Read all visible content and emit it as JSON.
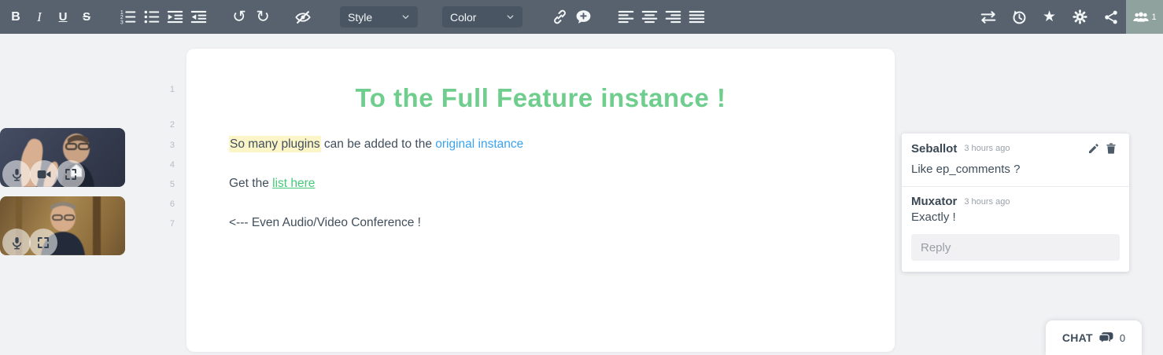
{
  "toolbar": {
    "format": {
      "bold": "B",
      "italic": "I",
      "underline": "U",
      "strikethrough": "S"
    },
    "undo_glyph": "↺",
    "redo_glyph": "↻",
    "star_glyph": "★",
    "style_dropdown_label": "Style",
    "color_dropdown_label": "Color",
    "users_count": "1"
  },
  "pad": {
    "line_numbers": [
      "1",
      "2",
      "3",
      "4",
      "5",
      "6",
      "7"
    ],
    "heading": "To the Full Feature instance !",
    "paragraph1": {
      "highlighted": "So many plugins",
      "middle": " can be added to the ",
      "link": "original instance"
    },
    "paragraph2": {
      "prefix": "Get the ",
      "link": "list here"
    },
    "paragraph3": "<--- Even Audio/Video Conference !"
  },
  "comments": {
    "items": [
      {
        "author": "Seballot",
        "time": "3 hours ago",
        "text": "Like ep_comments ?"
      },
      {
        "author": "Muxator",
        "time": "3 hours ago",
        "text": "Exactly !"
      }
    ],
    "reply_placeholder": "Reply"
  },
  "chat": {
    "label": "CHAT",
    "count": "0"
  },
  "video": {
    "participant1_controls": [
      "microphone",
      "camera",
      "fullscreen"
    ],
    "participant2_controls": [
      "microphone",
      "fullscreen"
    ]
  },
  "colors": {
    "toolbar_bg": "#57626e",
    "dropdown_bg": "#495563",
    "users_button_bg": "#8fa29e",
    "heading_green": "#6fce8e",
    "link_blue": "#3aa3f0",
    "link_green": "#45c878",
    "highlight_yellow": "#fcf5c7",
    "body_text": "#414e5c"
  }
}
